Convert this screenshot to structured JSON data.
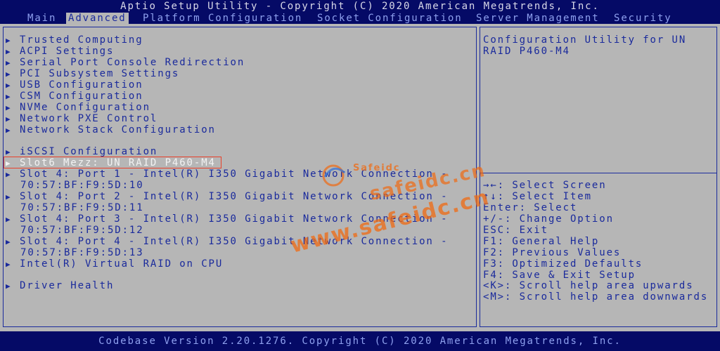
{
  "title": "Aptio Setup Utility - Copyright (C) 2020 American Megatrends, Inc.",
  "tabs": [
    {
      "label": "Main",
      "active": false
    },
    {
      "label": "Advanced",
      "active": true
    },
    {
      "label": "Platform Configuration",
      "active": false
    },
    {
      "label": "Socket Configuration",
      "active": false
    },
    {
      "label": "Server Management",
      "active": false
    },
    {
      "label": "Security",
      "active": false
    }
  ],
  "menu": {
    "items": [
      {
        "label": "Trusted Computing"
      },
      {
        "label": "ACPI Settings"
      },
      {
        "label": "Serial Port Console Redirection"
      },
      {
        "label": "PCI Subsystem Settings"
      },
      {
        "label": "USB Configuration"
      },
      {
        "label": "CSM Configuration"
      },
      {
        "label": "NVMe Configuration"
      },
      {
        "label": "Network PXE Control"
      },
      {
        "label": "Network Stack Configuration"
      },
      {
        "label": "iSCSI Configuration"
      },
      {
        "label": "Slot6 Mezz: UN RAID P460-M4"
      },
      {
        "label": "Slot 4: Port 1 - Intel(R) I350 Gigabit Network Connection -",
        "cont": "70:57:BF:F9:5D:10"
      },
      {
        "label": "Slot 4: Port 2 - Intel(R) I350 Gigabit Network Connection -",
        "cont": "70:57:BF:F9:5D:11"
      },
      {
        "label": "Slot 4: Port 3 - Intel(R) I350 Gigabit Network Connection -",
        "cont": "70:57:BF:F9:5D:12"
      },
      {
        "label": "Slot 4: Port 4 - Intel(R) I350 Gigabit Network Connection -",
        "cont": "70:57:BF:F9:5D:13"
      },
      {
        "label": "Intel(R) Virtual RAID on CPU"
      },
      {
        "label": "Driver Health"
      }
    ]
  },
  "help": {
    "description": [
      "Configuration Utility for UN",
      "RAID P460-M4"
    ],
    "keys": [
      "→←: Select Screen",
      "↑↓: Select Item",
      "Enter: Select",
      "+/-: Change Option",
      "ESC: Exit",
      "F1: General Help",
      "F2: Previous Values",
      "F3: Optimized Defaults",
      "F4: Save & Exit Setup",
      "<K>: Scroll help area upwards",
      "<M>: Scroll help area downwards"
    ]
  },
  "footer": "Codebase Version 2.20.1276. Copyright (C) 2020 American Megatrends, Inc.",
  "watermark": {
    "text1": "safeidc.cn",
    "text2": "www.safeidc.cn",
    "logo": "Safeidc"
  },
  "colors": {
    "bios_blue": "#050a66",
    "panel_gray": "#b6b6b6",
    "text_blue": "#1a2a9c",
    "highlight_red": "#e8402a",
    "watermark_orange": "#f06a12"
  }
}
